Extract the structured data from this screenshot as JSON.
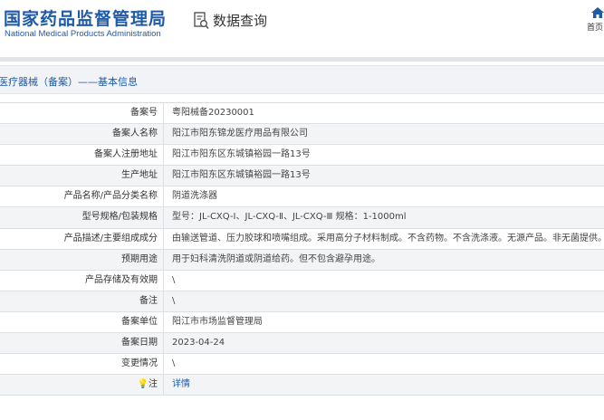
{
  "header": {
    "logo_cn": "国家药品监督管理局",
    "logo_en": "National Medical Products Administration",
    "query_label": "数据查询",
    "home_label": "首页"
  },
  "breadcrumb": "医疗器械（备案）——基本信息",
  "rows": [
    {
      "label": "备案号",
      "value": "粤阳械备20230001"
    },
    {
      "label": "备案人名称",
      "value": "阳江市阳东锦龙医疗用品有限公司"
    },
    {
      "label": "备案人注册地址",
      "value": "阳江市阳东区东城镇裕园一路13号"
    },
    {
      "label": "生产地址",
      "value": "阳江市阳东区东城镇裕园一路13号"
    },
    {
      "label": "产品名称/产品分类名称",
      "value": "阴道洗涤器"
    },
    {
      "label": "型号规格/包装规格",
      "value": "型号：JL-CXQ-Ⅰ、JL-CXQ-Ⅱ、JL-CXQ-Ⅲ 规格：1-1000ml"
    },
    {
      "label": "产品描述/主要组成成分",
      "value": "由输送管道、压力胶球和喷嘴组成。采用高分子材料制成。不含药物。不含洗涤液。无源产品。非无菌提供。"
    },
    {
      "label": "预期用途",
      "value": "用于妇科清洗阴道或阴道给药。但不包含避孕用途。"
    },
    {
      "label": "产品存储及有效期",
      "value": "\\"
    },
    {
      "label": "备注",
      "value": "\\"
    },
    {
      "label": "备案单位",
      "value": "阳江市市场监督管理局"
    },
    {
      "label": "备案日期",
      "value": "2023-04-24"
    },
    {
      "label": "变更情况",
      "value": "\\"
    },
    {
      "label": "注",
      "value": "详情"
    }
  ],
  "colors": {
    "brand": "#1f5aa8",
    "row_alt": "#f3f4f6"
  },
  "icons": {
    "query": "document-search-icon",
    "home": "home-icon",
    "note": "lightbulb-icon"
  }
}
